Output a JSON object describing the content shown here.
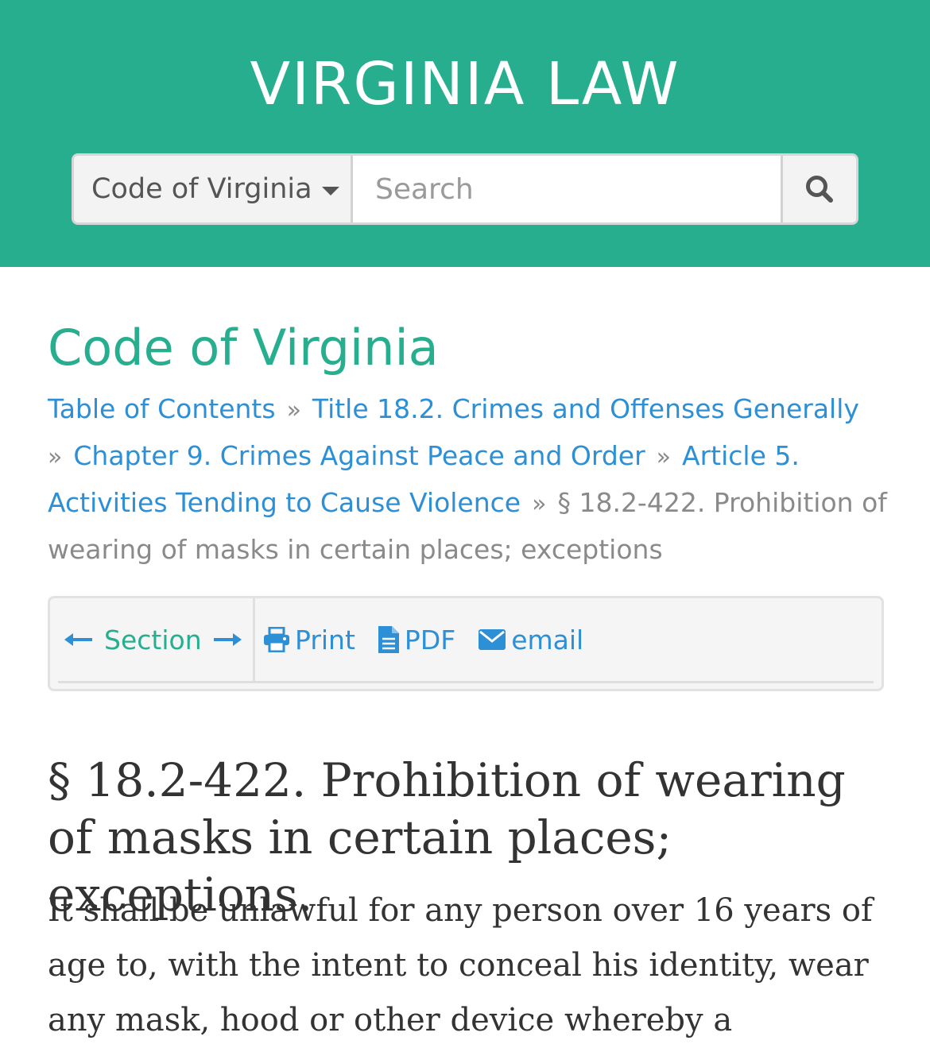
{
  "header": {
    "site_title": "VIRGINIA LAW",
    "scope_selected": "Code of Virginia",
    "search_placeholder": "Search",
    "search_value": ""
  },
  "content": {
    "title": "Code of Virginia",
    "breadcrumb": [
      {
        "label": "Table of Contents",
        "link": true
      },
      {
        "label": "Title 18.2. Crimes and Offenses Generally",
        "link": true
      },
      {
        "label": "Chapter 9. Crimes Against Peace and Order",
        "link": true
      },
      {
        "label": "Article 5. Activities Tending to Cause Violence",
        "link": true
      },
      {
        "label": "§ 18.2-422. Prohibition of wearing of masks in certain places; exceptions",
        "link": false
      }
    ],
    "breadcrumb_separator": "»"
  },
  "toolbar": {
    "section_label": "Section",
    "print_label": "Print",
    "pdf_label": "PDF",
    "email_label": "email"
  },
  "section": {
    "heading": "§ 18.2-422. Prohibition of wearing of masks in certain places; exceptions.",
    "body": "It shall be unlawful for any person over 16 years of age to, with the intent to conceal his identity, wear any mask, hood or other device whereby a"
  },
  "colors": {
    "header_bg": "#27ae8f",
    "title_green": "#27ae8f",
    "link_blue": "#2d8fd5",
    "muted_gray": "#8a8a8a"
  },
  "icons": {
    "scope_caret": "caret-down-icon",
    "search": "search-icon",
    "prev": "arrow-left-icon",
    "next": "arrow-right-icon",
    "print": "print-icon",
    "pdf": "file-text-icon",
    "email": "envelope-icon"
  }
}
